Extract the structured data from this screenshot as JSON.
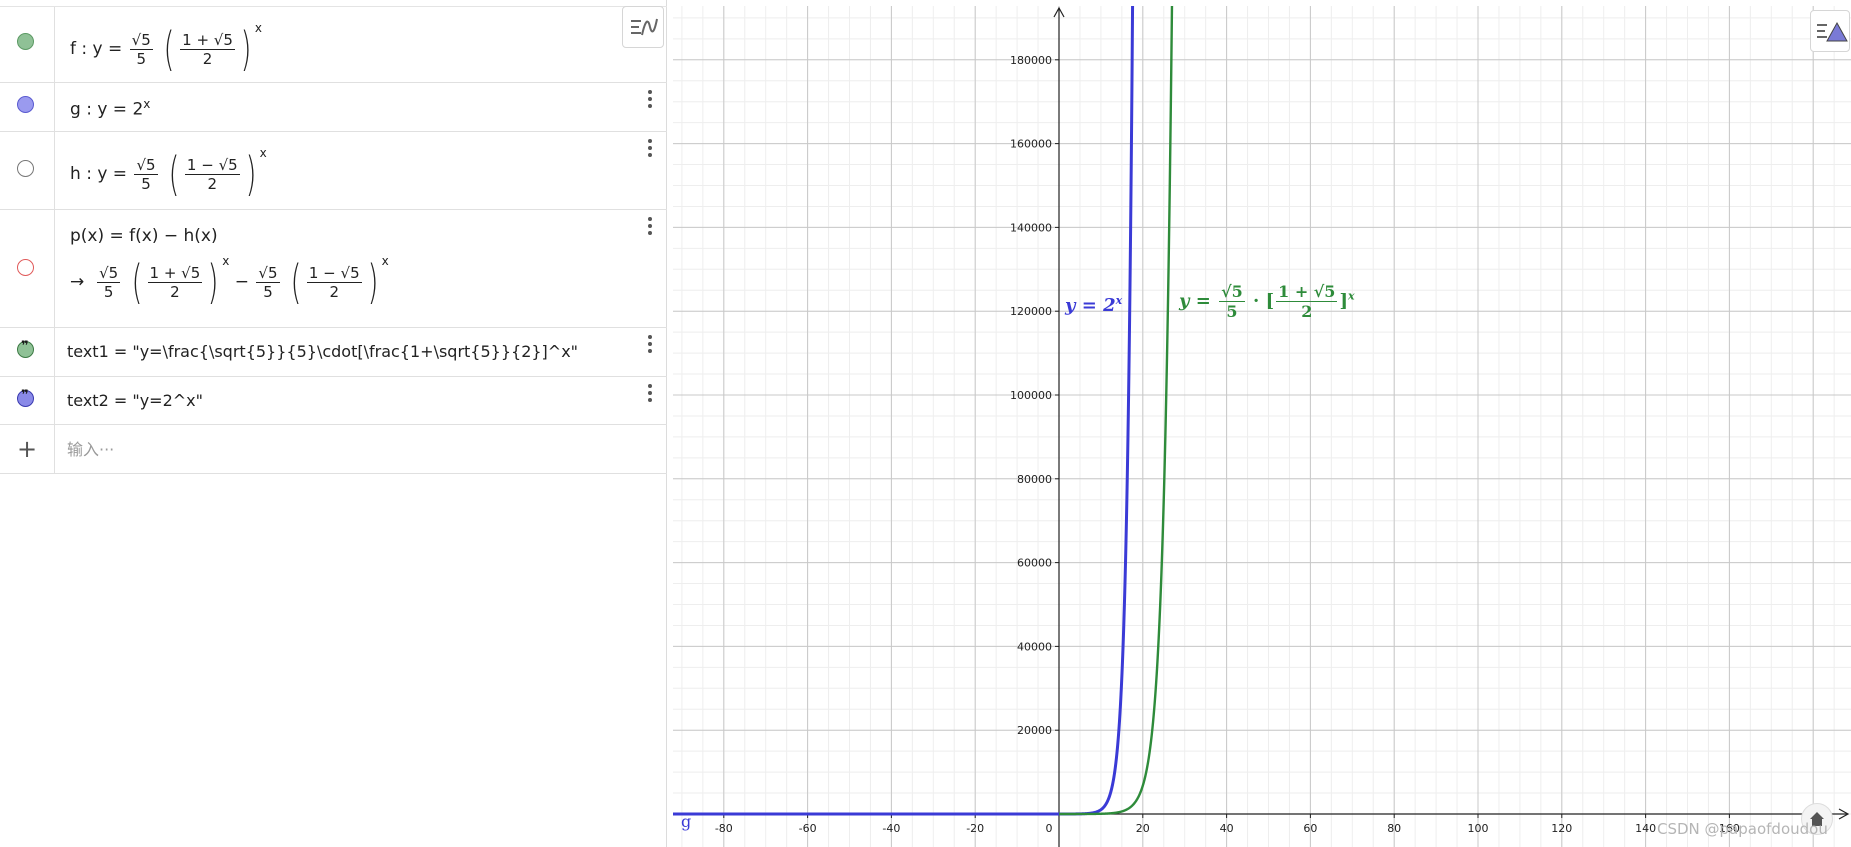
{
  "algebra": {
    "rows": [
      {
        "id": "f",
        "name": "f",
        "sep": ":",
        "lhs": "y =",
        "num": "√5",
        "den": "5",
        "inner_num": "1 + √5",
        "inner_den": "2",
        "exp": "x",
        "color": "#8fc196"
      },
      {
        "id": "g",
        "name": "g",
        "sep": ":",
        "lhs": "y = 2",
        "exp": "x",
        "color": "#9a9aef"
      },
      {
        "id": "h",
        "name": "h",
        "sep": ":",
        "lhs": "y =",
        "num": "√5",
        "den": "5",
        "inner_num": "1 − √5",
        "inner_den": "2",
        "exp": "x",
        "color": "#ffffff"
      },
      {
        "id": "p",
        "def": "p(x)  =  f(x) − h(x)",
        "arrow": "→",
        "num": "√5",
        "den": "5",
        "inner_num1": "1 + √5",
        "inner_den1": "2",
        "minus": "−",
        "num2": "√5",
        "den2": "5",
        "inner_num2": "1 − √5",
        "inner_den2": "2",
        "exp": "x",
        "color": "#ffffff"
      },
      {
        "id": "text1",
        "text": "text1  =  \"y=\\frac{\\sqrt{5}}{5}\\cdot[\\frac{1+\\sqrt{5}}{2}]^x\"",
        "color": "#8fc196"
      },
      {
        "id": "text2",
        "text": "text2  =  \"y=2^x\"",
        "color": "#8a8ae8"
      }
    ],
    "add_icon": "+",
    "input_placeholder": "输入···"
  },
  "graphics": {
    "x_ticks": [
      "-80",
      "-60",
      "-40",
      "-20",
      "0",
      "20",
      "40",
      "60",
      "80",
      "100",
      "120",
      "140",
      "160"
    ],
    "y_ticks": [
      "20000",
      "40000",
      "60000",
      "80000",
      "100000",
      "120000",
      "140000",
      "160000",
      "180000"
    ],
    "label_g": "y = 2",
    "label_g_exp": "x",
    "label_f_lhs": "y =",
    "label_f_num": "√5",
    "label_f_den": "5",
    "label_f_dot": "·",
    "label_f_inner_num": "1 + √5",
    "label_f_inner_den": "2",
    "label_f_exp": "x",
    "g_axis_label": "g",
    "colors": {
      "f": "#2e8b3a",
      "g": "#3a3ad6",
      "grid_major": "#c8c8c8",
      "grid_minor": "#eeeeee"
    }
  },
  "watermark": "CSDN @papaofdoudou"
}
